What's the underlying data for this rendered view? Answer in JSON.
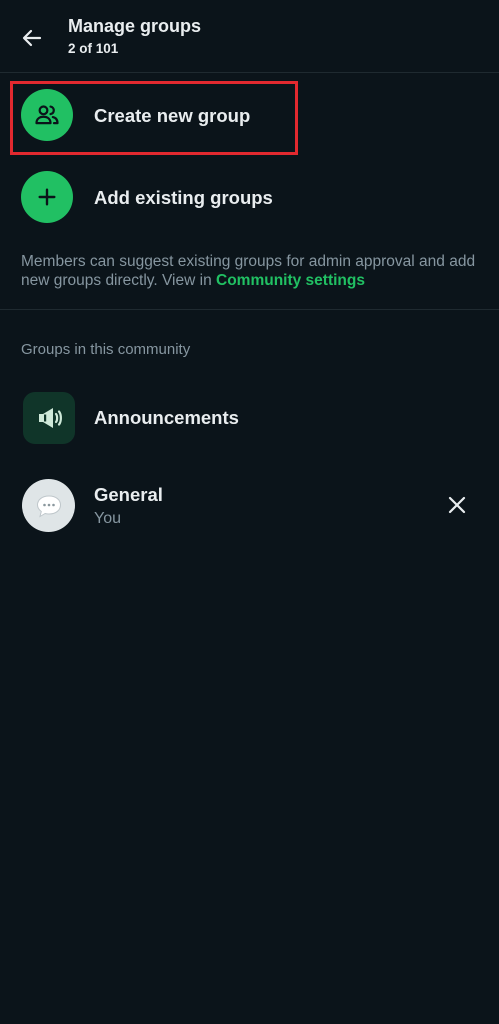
{
  "header": {
    "title": "Manage groups",
    "subtitle": "2 of 101"
  },
  "actions": {
    "create_label": "Create new group",
    "add_existing_label": "Add existing groups"
  },
  "info": {
    "text": "Members can suggest existing groups for admin approval and add new groups directly. View in ",
    "link": "Community settings"
  },
  "groups_section": {
    "heading": "Groups in this community",
    "items": [
      {
        "name": "Announcements",
        "icon": "megaphone-icon"
      },
      {
        "name": "General",
        "subtitle": "You",
        "icon": "chat-bubble-icon"
      }
    ]
  },
  "colors": {
    "background": "#0b141a",
    "accent": "#21c063",
    "highlight": "#e2292f",
    "secondary_text": "#8696a0"
  }
}
